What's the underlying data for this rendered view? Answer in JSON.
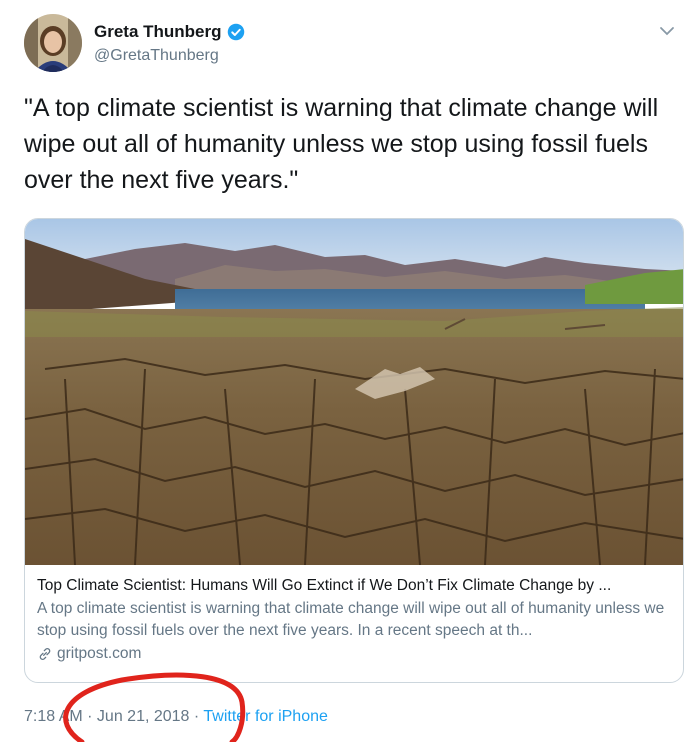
{
  "author": {
    "display_name": "Greta Thunberg",
    "handle": "@GretaThunberg",
    "verified": true
  },
  "tweet": {
    "text": "\"A top climate scientist is warning that climate change will wipe out all of humanity unless we stop using fossil fuels over the next five years.\""
  },
  "link_card": {
    "title": "Top Climate Scientist: Humans Will Go Extinct if We Don’t Fix Climate Change by ...",
    "description": "A top climate scientist is warning that climate change will wipe out all of humanity unless we stop using fossil fuels over the next five years. In a recent speech at th...",
    "domain": "gritpost.com",
    "image_icon": "dry-lakebed-photo"
  },
  "meta": {
    "time": "7:18 AM",
    "separator1": " · ",
    "date": "Jun 21, 2018",
    "separator2": " · ",
    "source": "Twitter for iPhone"
  },
  "colors": {
    "link_blue": "#1da1f2",
    "muted_gray": "#657786",
    "annotation_red": "#e0241c"
  },
  "icons": {
    "verified": "verified-badge-icon",
    "caret": "chevron-down-icon",
    "link": "link-icon"
  }
}
